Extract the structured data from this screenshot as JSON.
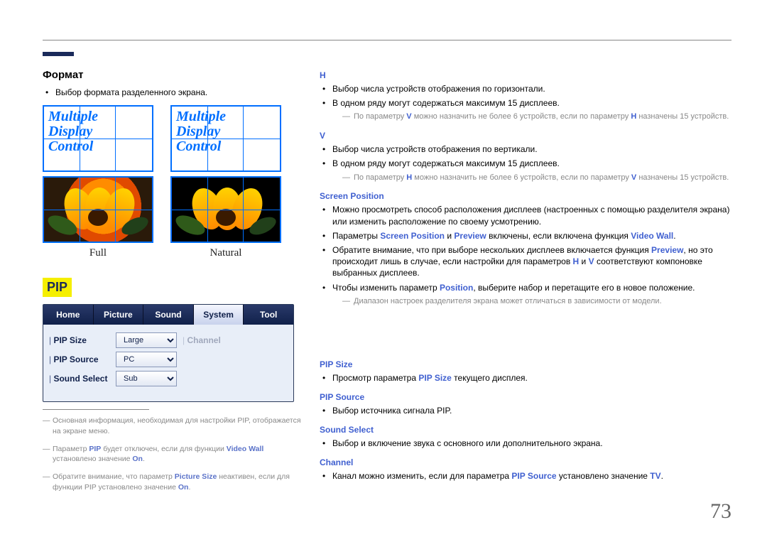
{
  "page_number": 73,
  "left": {
    "format_heading": "Формат",
    "format_desc": "Выбор формата разделенного экрана.",
    "mdc_text": "Multiple Display Control",
    "caption_full": "Full",
    "caption_natural": "Natural",
    "pip_badge": "PIP",
    "tabs": {
      "home": "Home",
      "picture": "Picture",
      "sound": "Sound",
      "system": "System",
      "tool": "Tool"
    },
    "pip_rows": {
      "pip_size_label": "PIP Size",
      "pip_size_value": "Large",
      "pip_source_label": "PIP Source",
      "pip_source_value": "PC",
      "sound_select_label": "Sound Select",
      "sound_select_value": "Sub",
      "channel_label": "Channel"
    },
    "footnotes": {
      "f1_a": "Основная информация, необходимая для настройки PIP, отображается на экране меню.",
      "f2_a": "Параметр ",
      "f2_kw1": "PIP",
      "f2_b": " будет отключен, если для функции ",
      "f2_kw2": "Video Wall",
      "f2_c": " установлено значение ",
      "f2_kw3": "On",
      "f2_d": ".",
      "f3_a": "Обратите внимание, что параметр ",
      "f3_kw1": "Picture Size",
      "f3_b": " неактивен, если для функции PIP установлено значение ",
      "f3_kw2": "On",
      "f3_c": "."
    }
  },
  "right": {
    "h": {
      "hdr": "H",
      "b1": "Выбор числа устройств отображения по горизонтали.",
      "b2": "В одном ряду могут содержаться максимум 15 дисплеев.",
      "n_a": "По параметру ",
      "n_kw1": "V",
      "n_b": " можно назначить не более 6 устройств, если по параметру ",
      "n_kw2": "H",
      "n_c": " назначены 15 устройств."
    },
    "v": {
      "hdr": "V",
      "b1": "Выбор числа устройств отображения по вертикали.",
      "b2": "В одном ряду могут содержаться максимум 15 дисплеев.",
      "n_a": "По параметру ",
      "n_kw1": "H",
      "n_b": " можно назначить не более 6 устройств, если по параметру ",
      "n_kw2": "V",
      "n_c": " назначены 15 устройств."
    },
    "sp": {
      "hdr": "Screen Position",
      "b1": "Можно просмотреть способ расположения дисплеев (настроенных с помощью разделителя экрана) или изменить расположение по своему усмотрению.",
      "b2_a": "Параметры ",
      "b2_kw1": "Screen Position",
      "b2_b": " и ",
      "b2_kw2": "Preview",
      "b2_c": " включены, если включена функция ",
      "b2_kw3": "Video Wall",
      "b2_d": ".",
      "b3_a": "Обратите внимание, что при выборе нескольких дисплеев включается функция ",
      "b3_kw1": "Preview",
      "b3_b": ", но это происходит лишь в случае, если настройки для параметров ",
      "b3_kw2": "H",
      "b3_c": " и ",
      "b3_kw3": "V",
      "b3_d": " соответствуют компоновке выбранных дисплеев.",
      "b4_a": "Чтобы изменить параметр ",
      "b4_kw1": "Position",
      "b4_b": ", выберите набор и перетащите его в новое положение.",
      "note": "Диапазон настроек разделителя экрана может отличаться в зависимости от модели."
    },
    "pip_size": {
      "hdr": "PIP Size",
      "b1_a": "Просмотр параметра ",
      "b1_kw": "PIP Size",
      "b1_b": " текущего дисплея."
    },
    "pip_source": {
      "hdr": "PIP Source",
      "b1": "Выбор источника сигнала PIP."
    },
    "sound_select": {
      "hdr": "Sound Select",
      "b1": "Выбор и включение звука с основного или дополнительного экрана."
    },
    "channel": {
      "hdr": "Channel",
      "b1_a": "Канал можно изменить, если для параметра ",
      "b1_kw1": "PIP Source",
      "b1_b": " установлено значение ",
      "b1_kw2": "TV",
      "b1_c": "."
    }
  }
}
